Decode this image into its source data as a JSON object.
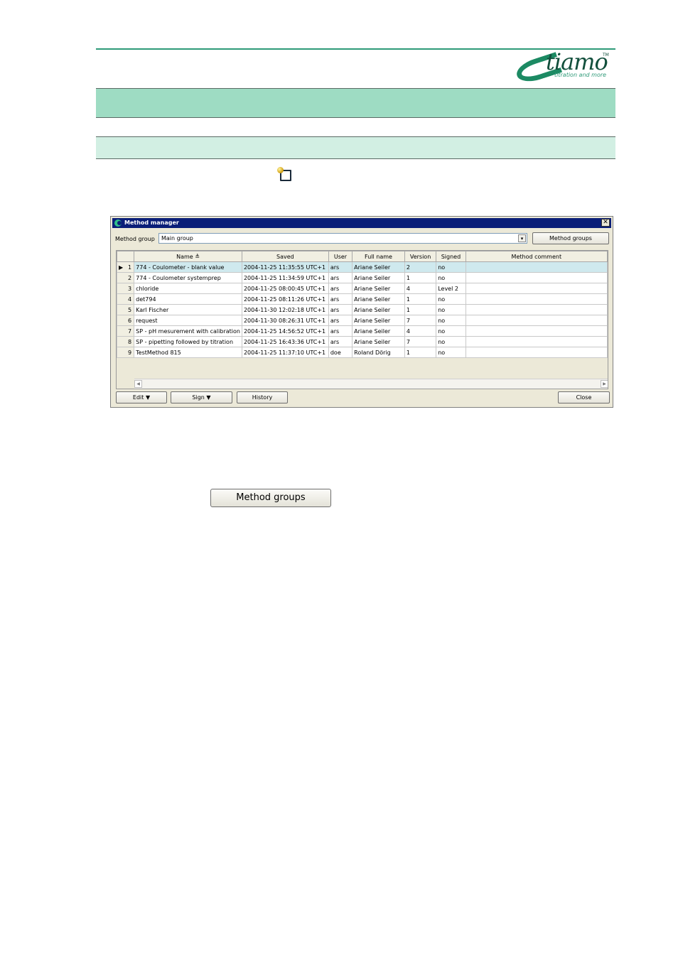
{
  "logo": {
    "word": "tiamo",
    "tm": "TM",
    "tagline": "titration and more"
  },
  "dialog": {
    "title": "Method manager",
    "close_glyph": "✕",
    "method_group_label": "Method group",
    "method_group_value": "Main group",
    "dropdown_glyph": "▾",
    "method_groups_button": "Method groups",
    "columns": [
      "",
      "Name ≜",
      "Saved",
      "User",
      "Full name",
      "Version",
      "Signed",
      "Method comment"
    ],
    "rows": [
      {
        "num": "1",
        "name": "774 - Coulometer - blank value",
        "saved": "2004-11-25 11:35:55 UTC+1",
        "user": "ars",
        "full_name": "Ariane Seiler",
        "version": "2",
        "signed": "no",
        "comment": ""
      },
      {
        "num": "2",
        "name": "774 - Coulometer systemprep",
        "saved": "2004-11-25 11:34:59 UTC+1",
        "user": "ars",
        "full_name": "Ariane Seiler",
        "version": "1",
        "signed": "no",
        "comment": ""
      },
      {
        "num": "3",
        "name": "chloride",
        "saved": "2004-11-25 08:00:45 UTC+1",
        "user": "ars",
        "full_name": "Ariane Seiler",
        "version": "4",
        "signed": "Level 2",
        "comment": ""
      },
      {
        "num": "4",
        "name": "det794",
        "saved": "2004-11-25 08:11:26 UTC+1",
        "user": "ars",
        "full_name": "Ariane Seiler",
        "version": "1",
        "signed": "no",
        "comment": ""
      },
      {
        "num": "5",
        "name": "Karl Fischer",
        "saved": "2004-11-30 12:02:18 UTC+1",
        "user": "ars",
        "full_name": "Ariane Seiler",
        "version": "1",
        "signed": "no",
        "comment": ""
      },
      {
        "num": "6",
        "name": "request",
        "saved": "2004-11-30 08:26:31 UTC+1",
        "user": "ars",
        "full_name": "Ariane Seiler",
        "version": "7",
        "signed": "no",
        "comment": ""
      },
      {
        "num": "7",
        "name": "SP - pH mesurement with calibration",
        "saved": "2004-11-25 14:56:52 UTC+1",
        "user": "ars",
        "full_name": "Ariane Seiler",
        "version": "4",
        "signed": "no",
        "comment": ""
      },
      {
        "num": "8",
        "name": "SP - pipetting followed by titration",
        "saved": "2004-11-25 16:43:36 UTC+1",
        "user": "ars",
        "full_name": "Ariane Seiler",
        "version": "7",
        "signed": "no",
        "comment": ""
      },
      {
        "num": "9",
        "name": "TestMethod 815",
        "saved": "2004-11-25 11:37:10 UTC+1",
        "user": "doe",
        "full_name": "Roland Dörig",
        "version": "1",
        "signed": "no",
        "comment": ""
      }
    ],
    "selected_row_marker": "▶",
    "scroll_left": "◀",
    "scroll_right": "▶",
    "buttons": {
      "edit": "Edit ▼",
      "sign": "Sign ▼",
      "history": "History",
      "close": "Close"
    }
  },
  "standalone_button": "Method groups"
}
